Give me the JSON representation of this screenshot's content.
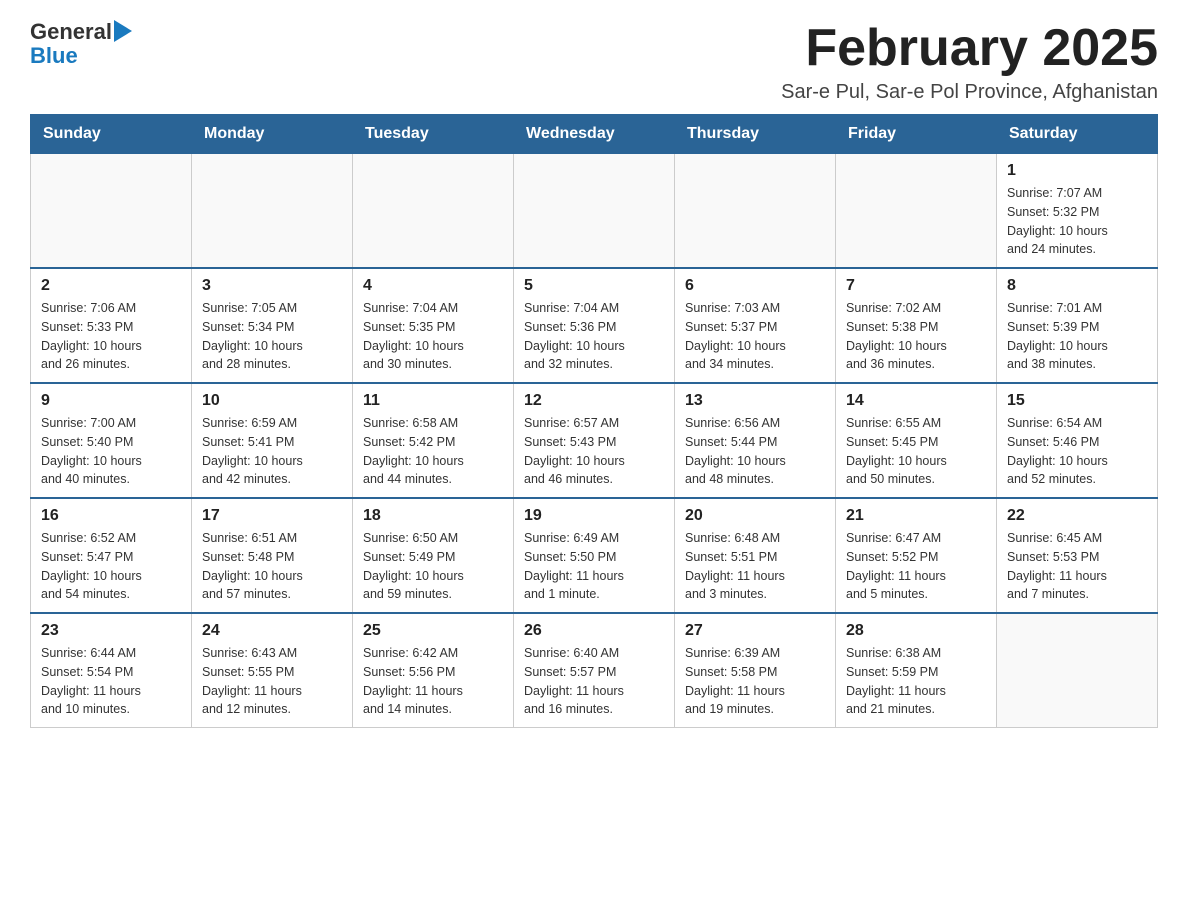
{
  "logo": {
    "general": "General",
    "blue": "Blue"
  },
  "header": {
    "title": "February 2025",
    "subtitle": "Sar-e Pul, Sar-e Pol Province, Afghanistan"
  },
  "weekdays": [
    "Sunday",
    "Monday",
    "Tuesday",
    "Wednesday",
    "Thursday",
    "Friday",
    "Saturday"
  ],
  "weeks": [
    [
      {
        "day": "",
        "info": ""
      },
      {
        "day": "",
        "info": ""
      },
      {
        "day": "",
        "info": ""
      },
      {
        "day": "",
        "info": ""
      },
      {
        "day": "",
        "info": ""
      },
      {
        "day": "",
        "info": ""
      },
      {
        "day": "1",
        "info": "Sunrise: 7:07 AM\nSunset: 5:32 PM\nDaylight: 10 hours\nand 24 minutes."
      }
    ],
    [
      {
        "day": "2",
        "info": "Sunrise: 7:06 AM\nSunset: 5:33 PM\nDaylight: 10 hours\nand 26 minutes."
      },
      {
        "day": "3",
        "info": "Sunrise: 7:05 AM\nSunset: 5:34 PM\nDaylight: 10 hours\nand 28 minutes."
      },
      {
        "day": "4",
        "info": "Sunrise: 7:04 AM\nSunset: 5:35 PM\nDaylight: 10 hours\nand 30 minutes."
      },
      {
        "day": "5",
        "info": "Sunrise: 7:04 AM\nSunset: 5:36 PM\nDaylight: 10 hours\nand 32 minutes."
      },
      {
        "day": "6",
        "info": "Sunrise: 7:03 AM\nSunset: 5:37 PM\nDaylight: 10 hours\nand 34 minutes."
      },
      {
        "day": "7",
        "info": "Sunrise: 7:02 AM\nSunset: 5:38 PM\nDaylight: 10 hours\nand 36 minutes."
      },
      {
        "day": "8",
        "info": "Sunrise: 7:01 AM\nSunset: 5:39 PM\nDaylight: 10 hours\nand 38 minutes."
      }
    ],
    [
      {
        "day": "9",
        "info": "Sunrise: 7:00 AM\nSunset: 5:40 PM\nDaylight: 10 hours\nand 40 minutes."
      },
      {
        "day": "10",
        "info": "Sunrise: 6:59 AM\nSunset: 5:41 PM\nDaylight: 10 hours\nand 42 minutes."
      },
      {
        "day": "11",
        "info": "Sunrise: 6:58 AM\nSunset: 5:42 PM\nDaylight: 10 hours\nand 44 minutes."
      },
      {
        "day": "12",
        "info": "Sunrise: 6:57 AM\nSunset: 5:43 PM\nDaylight: 10 hours\nand 46 minutes."
      },
      {
        "day": "13",
        "info": "Sunrise: 6:56 AM\nSunset: 5:44 PM\nDaylight: 10 hours\nand 48 minutes."
      },
      {
        "day": "14",
        "info": "Sunrise: 6:55 AM\nSunset: 5:45 PM\nDaylight: 10 hours\nand 50 minutes."
      },
      {
        "day": "15",
        "info": "Sunrise: 6:54 AM\nSunset: 5:46 PM\nDaylight: 10 hours\nand 52 minutes."
      }
    ],
    [
      {
        "day": "16",
        "info": "Sunrise: 6:52 AM\nSunset: 5:47 PM\nDaylight: 10 hours\nand 54 minutes."
      },
      {
        "day": "17",
        "info": "Sunrise: 6:51 AM\nSunset: 5:48 PM\nDaylight: 10 hours\nand 57 minutes."
      },
      {
        "day": "18",
        "info": "Sunrise: 6:50 AM\nSunset: 5:49 PM\nDaylight: 10 hours\nand 59 minutes."
      },
      {
        "day": "19",
        "info": "Sunrise: 6:49 AM\nSunset: 5:50 PM\nDaylight: 11 hours\nand 1 minute."
      },
      {
        "day": "20",
        "info": "Sunrise: 6:48 AM\nSunset: 5:51 PM\nDaylight: 11 hours\nand 3 minutes."
      },
      {
        "day": "21",
        "info": "Sunrise: 6:47 AM\nSunset: 5:52 PM\nDaylight: 11 hours\nand 5 minutes."
      },
      {
        "day": "22",
        "info": "Sunrise: 6:45 AM\nSunset: 5:53 PM\nDaylight: 11 hours\nand 7 minutes."
      }
    ],
    [
      {
        "day": "23",
        "info": "Sunrise: 6:44 AM\nSunset: 5:54 PM\nDaylight: 11 hours\nand 10 minutes."
      },
      {
        "day": "24",
        "info": "Sunrise: 6:43 AM\nSunset: 5:55 PM\nDaylight: 11 hours\nand 12 minutes."
      },
      {
        "day": "25",
        "info": "Sunrise: 6:42 AM\nSunset: 5:56 PM\nDaylight: 11 hours\nand 14 minutes."
      },
      {
        "day": "26",
        "info": "Sunrise: 6:40 AM\nSunset: 5:57 PM\nDaylight: 11 hours\nand 16 minutes."
      },
      {
        "day": "27",
        "info": "Sunrise: 6:39 AM\nSunset: 5:58 PM\nDaylight: 11 hours\nand 19 minutes."
      },
      {
        "day": "28",
        "info": "Sunrise: 6:38 AM\nSunset: 5:59 PM\nDaylight: 11 hours\nand 21 minutes."
      },
      {
        "day": "",
        "info": ""
      }
    ]
  ]
}
